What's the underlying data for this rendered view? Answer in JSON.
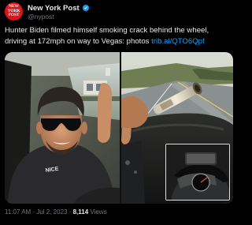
{
  "account": {
    "display_name": "New York Post",
    "handle": "@nypost",
    "avatar_logo_text": "NEW YORK POST",
    "verified_icon": "verified-badge-icon",
    "verified_color": "#1d9bf0",
    "brand_color": "#d8141c"
  },
  "tweet": {
    "text": "Hunter Biden filmed himself smoking crack behind the wheel, driving at 172mph on way to Vegas: photos ",
    "link": "trib.al/QTO6Qpf",
    "link_color": "#1d9bf0"
  },
  "media": {
    "photo_left_shirt_text": "NICE",
    "images": [
      "man-in-car-photo",
      "pipe-over-highway-photo",
      "speedometer-inset-photo"
    ]
  },
  "meta": {
    "time": "11:07 AM",
    "sep1": " · ",
    "date": "Jul 2, 2023",
    "sep2": " · ",
    "views": "8,114",
    "views_label": " Views"
  }
}
